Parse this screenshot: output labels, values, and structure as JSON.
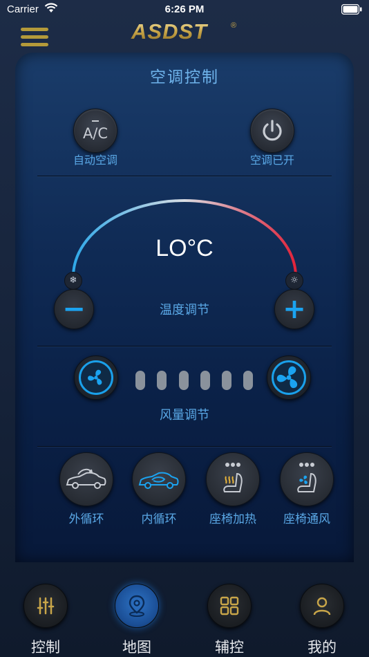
{
  "status": {
    "carrier": "Carrier",
    "time": "6:26 PM"
  },
  "brand": {
    "logo_text": "ASDST",
    "registered": "®"
  },
  "panel": {
    "title": "空调控制"
  },
  "ac": {
    "auto_label": "自动空调",
    "auto_button_text": "A/C",
    "power_label": "空调已开"
  },
  "temperature": {
    "value": "LO°C",
    "label": "温度调节",
    "minus": "−",
    "plus": "+"
  },
  "fan": {
    "label": "风量调节",
    "levels": 6
  },
  "features": [
    {
      "label": "外循环"
    },
    {
      "label": "内循环"
    },
    {
      "label": "座椅加热"
    },
    {
      "label": "座椅通风"
    }
  ],
  "tabs": [
    {
      "label": "控制",
      "active": false
    },
    {
      "label": "地图",
      "active": true
    },
    {
      "label": "辅控",
      "active": false
    },
    {
      "label": "我的",
      "active": false
    }
  ],
  "colors": {
    "accent": "#1ba3f0",
    "label_blue": "#5aa8e6",
    "gold": "#b49a3a",
    "arc_start": "#2fa8e8",
    "arc_end": "#e0233a"
  }
}
